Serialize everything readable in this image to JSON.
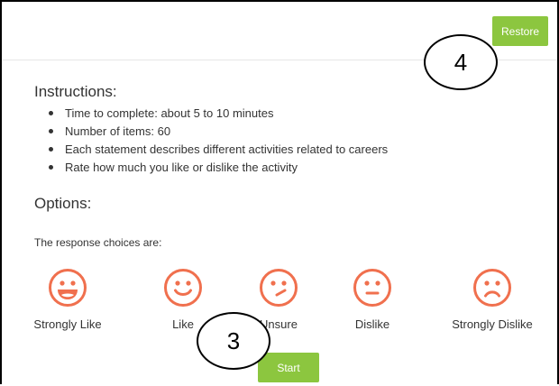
{
  "header": {
    "restore_label": "Restore"
  },
  "instructions": {
    "heading": "Instructions:",
    "items": [
      "Time to complete: about 5 to 10 minutes",
      "Number of items: 60",
      "Each statement describes different activities related to careers",
      "Rate how much you like or dislike the activity"
    ]
  },
  "options": {
    "heading": "Options:",
    "intro": "The response choices are:",
    "choices": [
      {
        "label": "Strongly Like",
        "icon": "laughing-face-icon"
      },
      {
        "label": "Like",
        "icon": "smiling-face-icon"
      },
      {
        "label": "Unsure",
        "icon": "confused-face-icon"
      },
      {
        "label": "Dislike",
        "icon": "neutral-face-icon"
      },
      {
        "label": "Strongly Dislike",
        "icon": "frowning-face-icon"
      }
    ]
  },
  "start_label": "Start",
  "callouts": {
    "restore": "4",
    "start": "3"
  },
  "colors": {
    "button_green": "#8cc63f",
    "face_orange": "#f0704e"
  }
}
